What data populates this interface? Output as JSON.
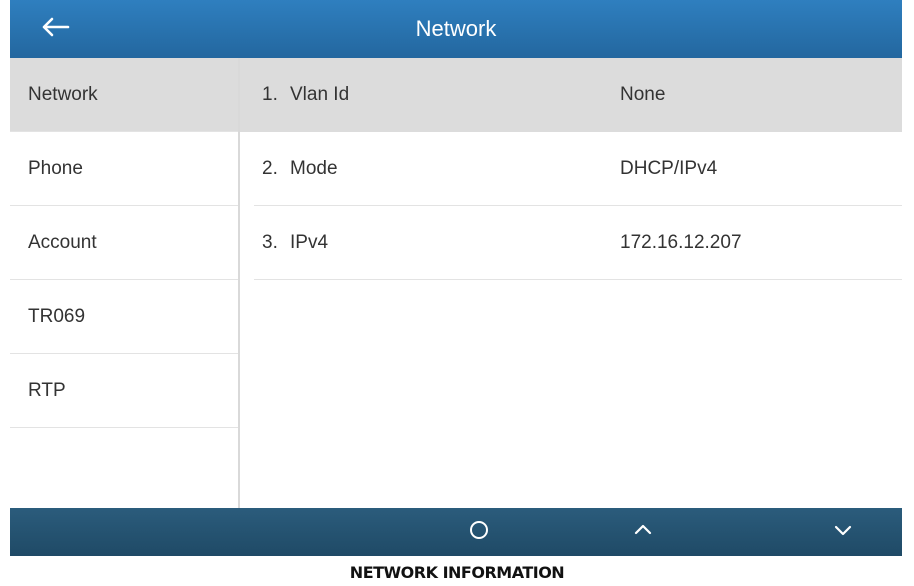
{
  "header": {
    "title": "Network",
    "back_icon": "arrow-left-icon"
  },
  "sidebar": {
    "items": [
      {
        "label": "Network",
        "active": true
      },
      {
        "label": "Phone",
        "active": false
      },
      {
        "label": "Account",
        "active": false
      },
      {
        "label": "TR069",
        "active": false
      },
      {
        "label": "RTP",
        "active": false
      }
    ]
  },
  "main": {
    "rows": [
      {
        "num": "1.",
        "label": "Vlan Id",
        "value": "None",
        "selected": true
      },
      {
        "num": "2.",
        "label": "Mode",
        "value": "DHCP/IPv4",
        "selected": false
      },
      {
        "num": "3.",
        "label": "IPv4",
        "value": "172.16.12.207",
        "selected": false
      }
    ]
  },
  "softkeys": {
    "icons": [
      "circle-icon",
      "chevron-up-icon",
      "chevron-down-icon"
    ]
  },
  "caption": "NETWORK INFORMATION",
  "colors": {
    "titlebar": "#2a73b0",
    "bottombar": "#234f6c",
    "selected_row": "#dcdcdc"
  }
}
